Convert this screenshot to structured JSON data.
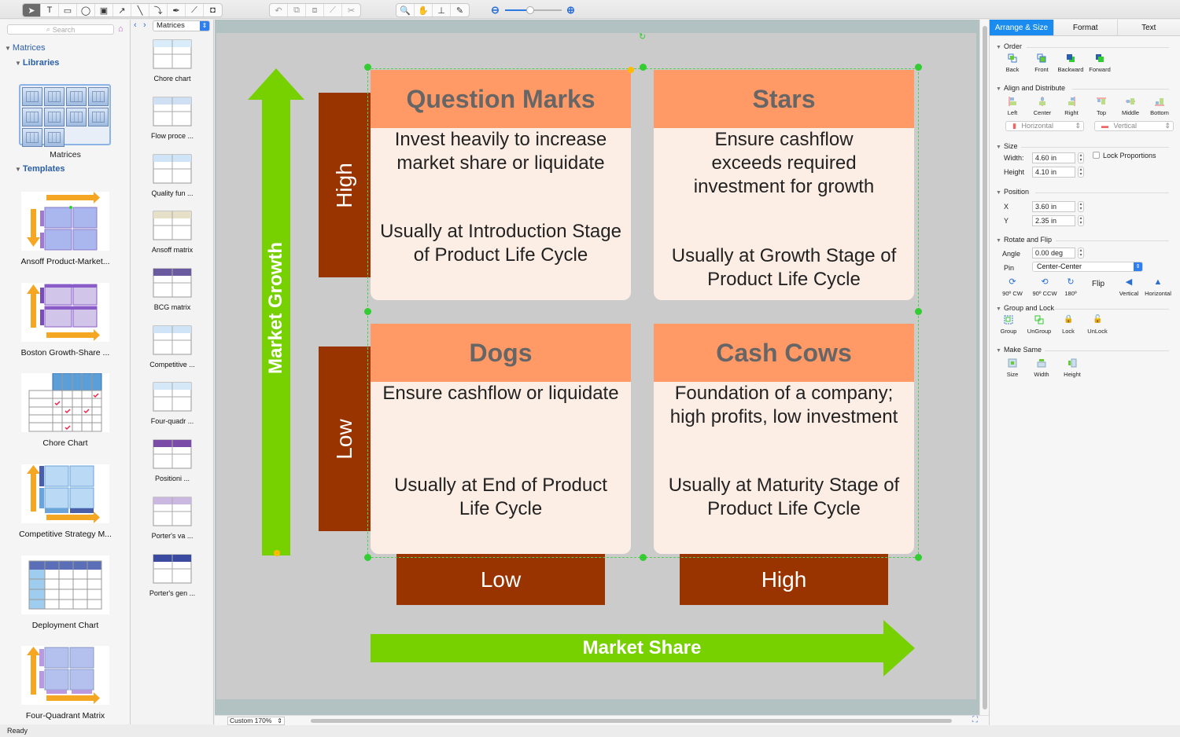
{
  "toolbar": {
    "draw_tools": [
      {
        "name": "pointer-tool",
        "glyph": "➤",
        "active": true
      },
      {
        "name": "text-tool",
        "glyph": "T"
      },
      {
        "name": "rectangle-tool",
        "glyph": "▭"
      },
      {
        "name": "ellipse-tool",
        "glyph": "◯"
      },
      {
        "name": "container-tool",
        "glyph": "▣"
      },
      {
        "name": "arrow-tool",
        "glyph": "↗"
      },
      {
        "name": "line-tool",
        "glyph": "╲"
      },
      {
        "name": "arc-tool",
        "glyph": "⤵"
      },
      {
        "name": "pen-tool",
        "glyph": "✒"
      },
      {
        "name": "polyline-tool",
        "glyph": "⟋"
      },
      {
        "name": "insert-tool",
        "glyph": "◘"
      }
    ],
    "edit_tools": [
      {
        "name": "rotate-tool",
        "glyph": "↶"
      },
      {
        "name": "group-tool",
        "glyph": "⧉"
      },
      {
        "name": "ungroup-tool",
        "glyph": "⧈"
      },
      {
        "name": "add-point-tool",
        "glyph": "⟋"
      },
      {
        "name": "cut-point-tool",
        "glyph": "✂"
      }
    ],
    "view_tools": [
      {
        "name": "zoom-tool",
        "glyph": "🔍"
      },
      {
        "name": "pan-tool",
        "glyph": "✋"
      },
      {
        "name": "stamp-tool",
        "glyph": "⊥"
      },
      {
        "name": "eyedropper-tool",
        "glyph": "✎"
      }
    ],
    "zoom_out_glyph": "⊖",
    "zoom_in_glyph": "⊕",
    "zoom_level_fraction": 0.45
  },
  "left_panel": {
    "search_placeholder": "Search",
    "tree_root": "Matrices",
    "libraries_label": "Libraries",
    "library_name": "Matrices",
    "templates_label": "Templates",
    "templates": [
      {
        "label": "Ansoff Product-Market..."
      },
      {
        "label": "Boston Growth-Share ..."
      },
      {
        "label": "Chore Chart"
      },
      {
        "label": "Competitive Strategy M..."
      },
      {
        "label": "Deployment Chart"
      },
      {
        "label": "Four-Quadrant Matrix"
      }
    ]
  },
  "library_strip": {
    "selected_library": "Matrices",
    "items": [
      {
        "label": "Chore chart"
      },
      {
        "label": "Flow proce ..."
      },
      {
        "label": "Quality fun ..."
      },
      {
        "label": "Ansoff matrix"
      },
      {
        "label": "BCG matrix"
      },
      {
        "label": "Competitive ..."
      },
      {
        "label": "Four-quadr ..."
      },
      {
        "label": "Positioni ..."
      },
      {
        "label": "Porter's va ..."
      },
      {
        "label": "Porter's gen ..."
      }
    ]
  },
  "diagram": {
    "vertical_axis_label": "Market Growth",
    "horizontal_axis_label": "Market Share",
    "row_labels": {
      "high": "High",
      "low": "Low"
    },
    "column_labels": {
      "low": "Low",
      "high": "High"
    },
    "quadrants": [
      {
        "title": "Question Marks",
        "strategy": "Invest heavily to increase market share or liquidate",
        "stage": "Usually at Introduction Stage of Product Life Cycle"
      },
      {
        "title": "Stars",
        "strategy": "Ensure cashflow exceeds required investment for growth",
        "stage": "Usually at Growth Stage of Product Life Cycle"
      },
      {
        "title": "Dogs",
        "strategy": "Ensure cashflow or liquidate",
        "stage": "Usually at End of Product Life Cycle"
      },
      {
        "title": "Cash Cows",
        "strategy": "Foundation of a company; high profits, low investment",
        "stage": "Usually at Maturity Stage of Product Life Cycle"
      }
    ],
    "colors": {
      "header": "#ff9966",
      "header_text": "#666666",
      "body": "#fdeee5",
      "label_block": "#993300",
      "arrow": "#77d100"
    }
  },
  "canvas_footer": {
    "zoom_select": "Custom 170%"
  },
  "status": {
    "text": "Ready"
  },
  "right_panel": {
    "tabs": [
      {
        "label": "Arrange & Size",
        "active": true
      },
      {
        "label": "Format"
      },
      {
        "label": "Text"
      }
    ],
    "order": {
      "title": "Order",
      "buttons": [
        "Back",
        "Front",
        "Backward",
        "Forward"
      ]
    },
    "align": {
      "title": "Align and Distribute",
      "buttons": [
        "Left",
        "Center",
        "Right",
        "Top",
        "Middle",
        "Bottom"
      ],
      "horizontal_select": "Horizontal",
      "vertical_select": "Vertical"
    },
    "size": {
      "title": "Size",
      "width_label": "Width:",
      "width_value": "4.60 in",
      "height_label": "Height",
      "height_value": "4.10 in",
      "lock_label": "Lock Proportions",
      "lock_checked": false
    },
    "position": {
      "title": "Position",
      "x_label": "X",
      "x_value": "3.60 in",
      "y_label": "Y",
      "y_value": "2.35 in"
    },
    "rotate": {
      "title": "Rotate and Flip",
      "angle_label": "Angle",
      "angle_value": "0.00 deg",
      "pin_label": "Pin",
      "pin_value": "Center-Center",
      "buttons": [
        "90º CW",
        "90º CCW",
        "180º"
      ],
      "flip_label": "Flip",
      "flip_buttons": [
        "Vertical",
        "Horizontal"
      ]
    },
    "group": {
      "title": "Group and Lock",
      "buttons": [
        "Group",
        "UnGroup",
        "Lock",
        "UnLock"
      ]
    },
    "make_same": {
      "title": "Make Same",
      "buttons": [
        "Size",
        "Width",
        "Height"
      ]
    }
  }
}
